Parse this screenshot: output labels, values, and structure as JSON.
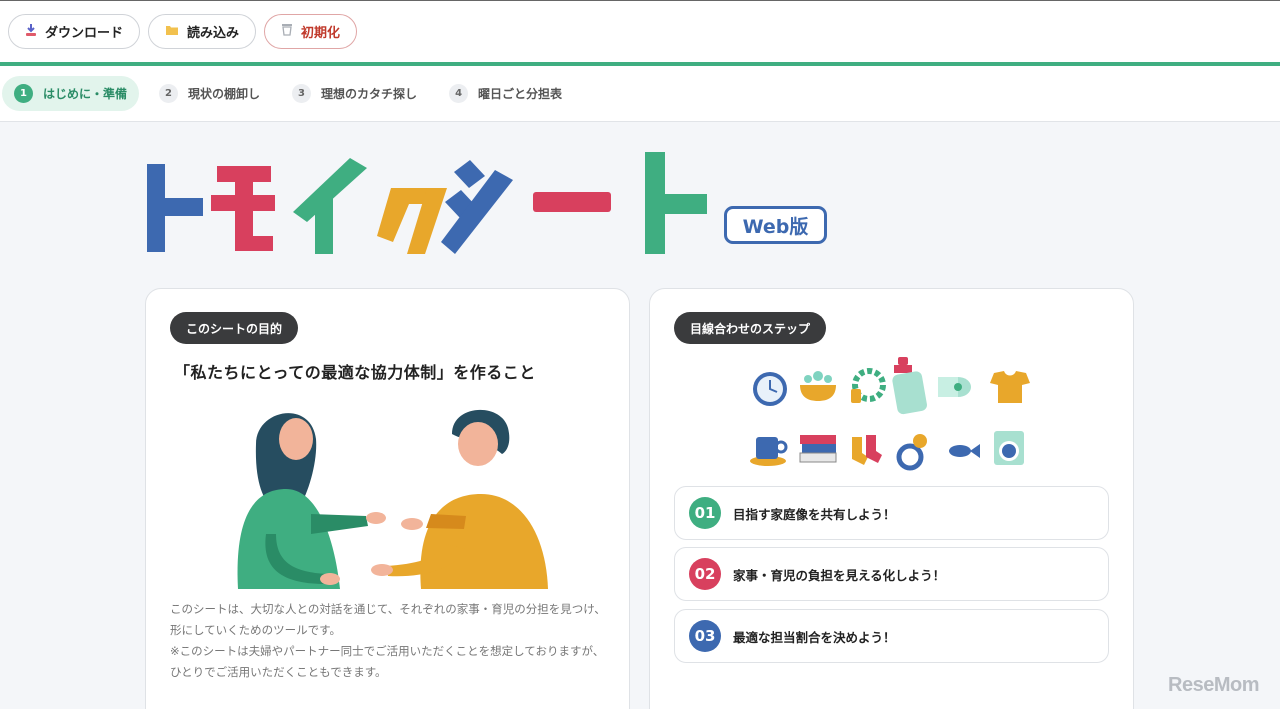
{
  "toolbar": {
    "download_label": "ダウンロード",
    "load_label": "読み込み",
    "reset_label": "初期化"
  },
  "tabs": [
    {
      "num": "1",
      "label": "はじめに・準備"
    },
    {
      "num": "2",
      "label": "現状の棚卸し"
    },
    {
      "num": "3",
      "label": "理想のカタチ探し"
    },
    {
      "num": "4",
      "label": "曜日ごと分担表"
    }
  ],
  "logo": {
    "title": "トモイクシート",
    "badge": "Web版"
  },
  "purpose_card": {
    "pill": "このシートの目的",
    "heading": "「私たちにとっての最適な協力体制」を作ること",
    "desc1": "このシートは、大切な人との対話を通じて、それぞれの家事・育児の分担を見つけ、形にしていくためのツールです。",
    "desc2": "※このシートは夫婦やパートナー同士でご活用いただくことを想定しておりますが、ひとりでご活用いただくこともできます。"
  },
  "steps_card": {
    "pill": "目線合わせのステップ",
    "steps": [
      {
        "num": "01",
        "text": "目指す家庭像を共有しよう！"
      },
      {
        "num": "02",
        "text": "家事・育児の負担を見える化しよう！"
      },
      {
        "num": "03",
        "text": "最適な担当割合を決めよう！"
      }
    ]
  },
  "colors": {
    "accent_green": "#3fae81",
    "blue": "#3d69b0",
    "red": "#d8405e",
    "yellow": "#e8a72b"
  },
  "watermark": "ReseMom"
}
